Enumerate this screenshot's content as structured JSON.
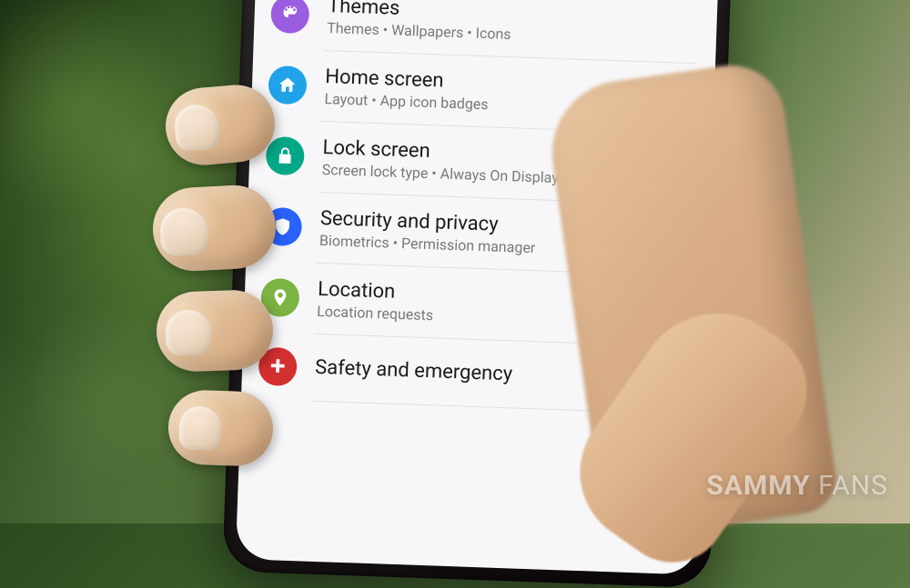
{
  "settings": [
    {
      "id": "themes",
      "title": "Themes",
      "subtitle": "Themes • Wallpapers • Icons",
      "icon": "brush",
      "color": "#9a5de0"
    },
    {
      "id": "home-screen",
      "title": "Home screen",
      "subtitle": "Layout • App icon badges",
      "icon": "home",
      "color": "#1fa2e8"
    },
    {
      "id": "lock-screen",
      "title": "Lock screen",
      "subtitle": "Screen lock type • Always On Display",
      "icon": "lock",
      "color": "#00a885"
    },
    {
      "id": "security-privacy",
      "title": "Security and privacy",
      "subtitle": "Biometrics • Permission manager",
      "icon": "shield",
      "color": "#2962ff"
    },
    {
      "id": "location",
      "title": "Location",
      "subtitle": "Location requests",
      "icon": "pin",
      "color": "#7cb342"
    },
    {
      "id": "safety-emergency",
      "title": "Safety and emergency",
      "subtitle": "",
      "icon": "medical",
      "color": "#d32f2f"
    }
  ],
  "watermark": {
    "brand": "SAMMY",
    "suffix": "FANS"
  }
}
